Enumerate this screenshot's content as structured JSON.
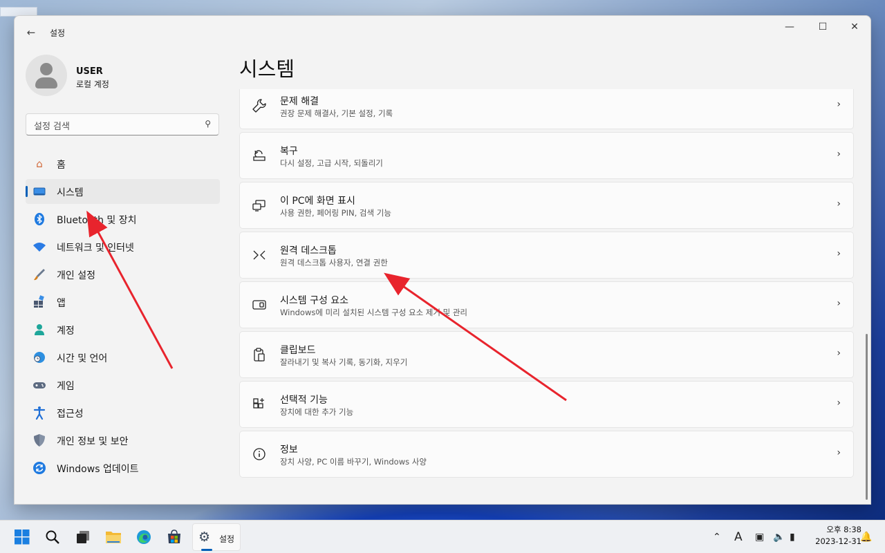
{
  "window": {
    "title": "설정"
  },
  "user": {
    "name": "USER",
    "account_type": "로컬 계정"
  },
  "search": {
    "placeholder": "설정 검색"
  },
  "nav": [
    {
      "label": "홈",
      "icon": "home-icon"
    },
    {
      "label": "시스템",
      "icon": "system-icon",
      "active": true
    },
    {
      "label": "Bluetooth 및 장치",
      "icon": "bluetooth-icon"
    },
    {
      "label": "네트워크 및 인터넷",
      "icon": "wifi-icon"
    },
    {
      "label": "개인 설정",
      "icon": "brush-icon"
    },
    {
      "label": "앱",
      "icon": "apps-icon"
    },
    {
      "label": "계정",
      "icon": "account-icon"
    },
    {
      "label": "시간 및 언어",
      "icon": "globe-clock-icon"
    },
    {
      "label": "게임",
      "icon": "gamepad-icon"
    },
    {
      "label": "접근성",
      "icon": "accessibility-icon"
    },
    {
      "label": "개인 정보 및 보안",
      "icon": "shield-icon"
    },
    {
      "label": "Windows 업데이트",
      "icon": "update-icon"
    }
  ],
  "main": {
    "title": "시스템",
    "cards": [
      {
        "title": "문제 해결",
        "desc": "권장 문제 해결사, 기본 설정, 기록",
        "icon": "wrench-icon"
      },
      {
        "title": "복구",
        "desc": "다시 설정, 고급 시작, 되돌리기",
        "icon": "recovery-icon"
      },
      {
        "title": "이 PC에 화면 표시",
        "desc": "사용 권한, 페어링 PIN, 검색 기능",
        "icon": "project-icon"
      },
      {
        "title": "원격 데스크톱",
        "desc": "원격 데스크톱 사용자, 연결 권한",
        "icon": "remote-desktop-icon"
      },
      {
        "title": "시스템 구성 요소",
        "desc": "Windows에 미리 설치된 시스템 구성 요소 제거 및 관리",
        "icon": "components-icon"
      },
      {
        "title": "클립보드",
        "desc": "잘라내기 및 복사 기록, 동기화, 지우기",
        "icon": "clipboard-icon"
      },
      {
        "title": "선택적 기능",
        "desc": "장치에 대한 추가 기능",
        "icon": "optional-features-icon"
      },
      {
        "title": "정보",
        "desc": "장치 사양, PC 이름 바꾸기, Windows 사양",
        "icon": "info-icon"
      }
    ]
  },
  "taskbar": {
    "settings_label": "설정",
    "clock": {
      "time": "오후 8:38",
      "date": "2023-12-31"
    }
  },
  "colors": {
    "accent": "#005fb8",
    "annotation_arrow": "#e8242d"
  }
}
